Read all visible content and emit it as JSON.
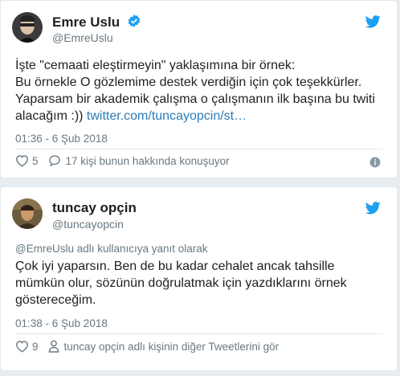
{
  "tweet1": {
    "name": "Emre Uslu",
    "handle": "@EmreUslu",
    "text_lines": [
      "İşte \"cemaati eleştirmeyin\" yaklaşımına bir örnek:",
      "Bu örnekle O gözlemime destek verdiğin için çok teşekkürler.",
      "Yaparsam bir akademik çalışma o çalışmanın ilk başına bu twiti",
      "alacağım :)) "
    ],
    "link": "twitter.com/tuncayopcin/st…",
    "time": "01:36 - 6 Şub 2018",
    "likes": "5",
    "conversation": "17 kişi bunun hakkında konuşuyor"
  },
  "tweet2": {
    "name": "tuncay opçin",
    "handle": "@tuncayopcin",
    "reply_to": "@EmreUslu adlı kullanıcıya yanıt olarak",
    "text_lines": [
      "Çok iyi yaparsın. Ben de bu kadar cehalet ancak tahsille",
      "mümkün olur, sözünün doğrulatmak için yazdıklarını örnek",
      "göstereceğim."
    ],
    "time": "01:38 - 6 Şub 2018",
    "likes": "9",
    "more_tweets": "tuncay opçin adlı kişinin diğer Tweetlerini gör"
  },
  "colors": {
    "twitter_blue": "#1da1f2",
    "link": "#2b7bb9",
    "secondary_text": "#697882"
  }
}
